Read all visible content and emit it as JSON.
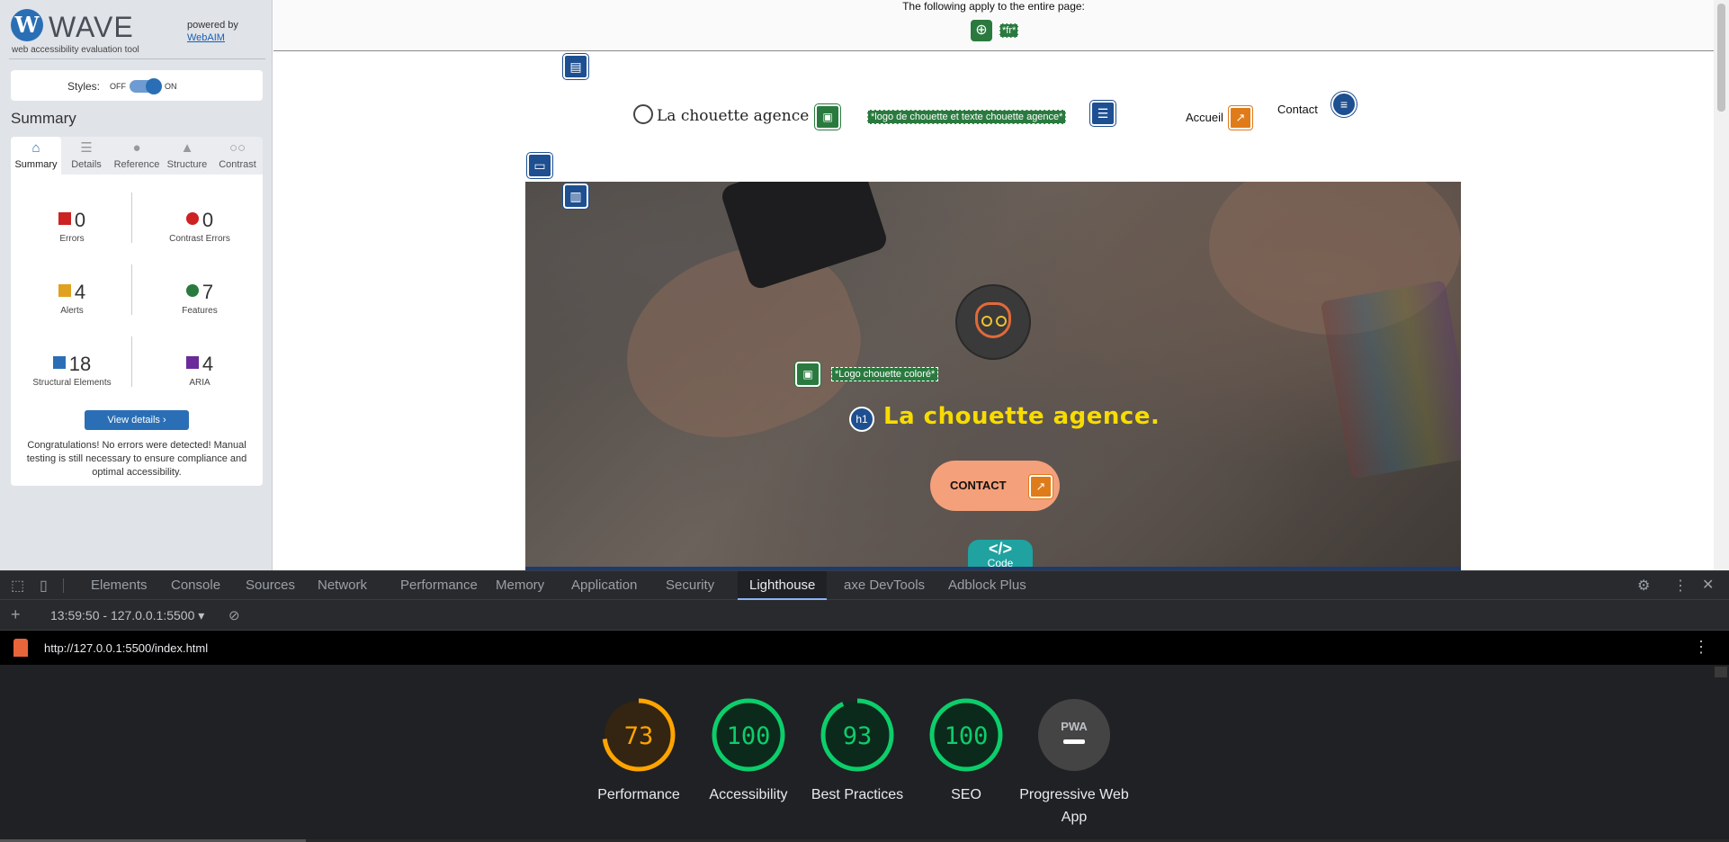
{
  "wave": {
    "logo_letter": "W",
    "title": "WAVE",
    "subtitle": "web accessibility evaluation tool",
    "powered_by": "powered by",
    "webaim": "WebAIM",
    "styles_label": "Styles:",
    "styles_off": "OFF",
    "styles_on": "ON",
    "summary_title": "Summary",
    "tabs": [
      {
        "label": "Summary",
        "icon": "home-icon"
      },
      {
        "label": "Details",
        "icon": "list-icon"
      },
      {
        "label": "Reference",
        "icon": "info-icon"
      },
      {
        "label": "Structure",
        "icon": "hierarchy-icon"
      },
      {
        "label": "Contrast",
        "icon": "contrast-icon"
      }
    ],
    "stats": {
      "errors": {
        "value": "0",
        "label": "Errors",
        "color": "#cc2222"
      },
      "contrast_errors": {
        "value": "0",
        "label": "Contrast Errors",
        "color": "#cc2222"
      },
      "alerts": {
        "value": "4",
        "label": "Alerts",
        "color": "#e0a020"
      },
      "features": {
        "value": "7",
        "label": "Features",
        "color": "#2a7a3f"
      },
      "structural": {
        "value": "18",
        "label": "Structural Elements",
        "color": "#2a6fb5"
      },
      "aria": {
        "value": "4",
        "label": "ARIA",
        "color": "#6a2a9a"
      }
    },
    "view_details": "View details ›",
    "congrats": "Congratulations! No errors were detected! Manual testing is still necessary to ensure compliance and optimal accessibility."
  },
  "page": {
    "notice": "The following apply to the entire page:",
    "lang_tag": "*fr*",
    "logo_text": "La chouette agence",
    "logo_alt": "*logo de chouette et texte chouette agence*",
    "nav_home": "Accueil",
    "nav_contact": "Contact",
    "hero_alt": "*Logo chouette coloré*",
    "h1_badge": "h1",
    "hero_title": "La chouette agence.",
    "contact_btn": "CONTACT",
    "code_glyph": "</>",
    "code_label": "Code"
  },
  "devtools": {
    "tabs": [
      "Elements",
      "Console",
      "Sources",
      "Network",
      "Performance",
      "Memory",
      "Application",
      "Security",
      "Lighthouse",
      "axe DevTools",
      "Adblock Plus"
    ],
    "active_tab": "Lighthouse",
    "report_time": "13:59:50 - 127.0.0.1:5500",
    "url": "http://127.0.0.1:5500/index.html",
    "scores": [
      {
        "label": "Performance",
        "value": 73,
        "color": "#ffa400"
      },
      {
        "label": "Accessibility",
        "value": 100,
        "color": "#0cce6b"
      },
      {
        "label": "Best Practices",
        "value": 93,
        "color": "#0cce6b"
      },
      {
        "label": "SEO",
        "value": 100,
        "color": "#0cce6b"
      }
    ],
    "pwa_label": "Progressive Web App",
    "pwa_text": "PWA"
  }
}
